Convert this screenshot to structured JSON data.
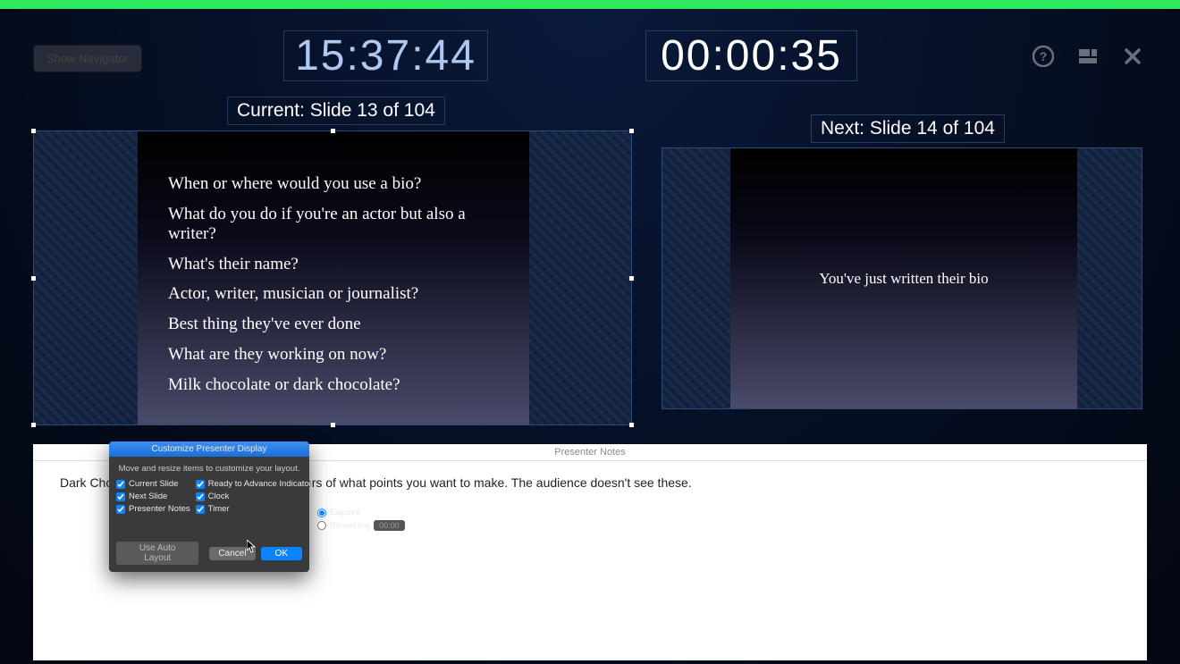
{
  "app": {
    "green_bar": true
  },
  "toolbar": {
    "show_navigator_label": "Show Navigator"
  },
  "clock": {
    "value": "15:37:44"
  },
  "timer": {
    "value": "00:00:35"
  },
  "current": {
    "label": "Current: Slide 13 of 104",
    "lines": [
      "When or where would you use a bio?",
      "What do you do if you're an actor but also a writer?",
      "What's their name?",
      "Actor, writer, musician or journalist?",
      "Best thing they've ever done",
      "What are they working on now?",
      "Milk chocolate or dark chocolate?"
    ]
  },
  "next": {
    "label": "Next: Slide 14 of 104",
    "text": "You've just written their bio"
  },
  "notes": {
    "header": "Presenter Notes",
    "body": "Dark Chocolate.                                                    e notes for yourself: reminders of what points you want to make. The audience doesn't see these."
  },
  "dialog": {
    "title": "Customize Presenter Display",
    "subtitle": "Move and resize items to customize your layout.",
    "col1": [
      {
        "label": "Current Slide",
        "checked": true
      },
      {
        "label": "Next Slide",
        "checked": true
      },
      {
        "label": "Presenter Notes",
        "checked": true
      }
    ],
    "col2": [
      {
        "label": "Ready to Advance Indicator",
        "checked": true
      },
      {
        "label": "Clock",
        "checked": true
      },
      {
        "label": "Timer",
        "checked": true
      }
    ],
    "col3": {
      "elapsed_label": "Elapsed",
      "remaining_label": "Remaining",
      "selected": "elapsed",
      "time_field": "00:00"
    },
    "auto_layout": "Use Auto Layout",
    "cancel": "Cancel",
    "ok": "OK"
  }
}
